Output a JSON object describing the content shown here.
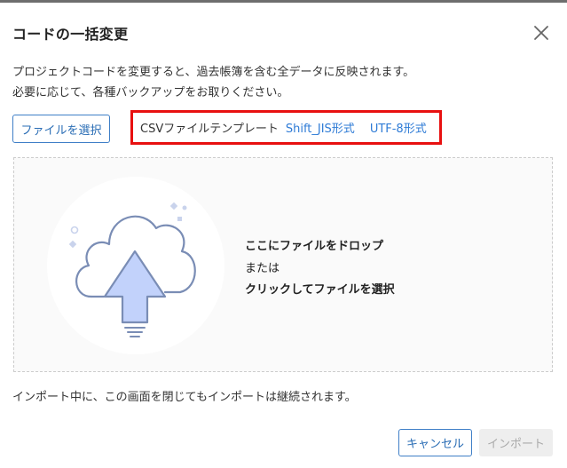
{
  "dialog": {
    "title": "コードの一括変更",
    "close_icon": "close-icon",
    "description_line1": "プロジェクトコードを変更すると、過去帳簿を含む全データに反映されます。",
    "description_line2": "必要に応じて、各種バックアップをお取りください。"
  },
  "file_select": {
    "button_label": "ファイルを選択"
  },
  "template": {
    "label": "CSVファイルテンプレート",
    "link_shift_jis": "Shift_JIS形式",
    "link_utf8": "UTF-8形式",
    "highlight_color": "#e81010"
  },
  "dropzone": {
    "icon": "cloud-upload-icon",
    "line1": "ここにファイルをドロップ",
    "line2": "または",
    "line3": "クリックしてファイルを選択"
  },
  "note": "インポート中に、この画面を閉じてもインポートは継続されます。",
  "footer": {
    "cancel_label": "キャンセル",
    "import_label": "インポート"
  },
  "colors": {
    "accent": "#2e7bd6",
    "illustration_stroke": "#7a8db5",
    "arrow_fill": "#c2d2fb"
  }
}
